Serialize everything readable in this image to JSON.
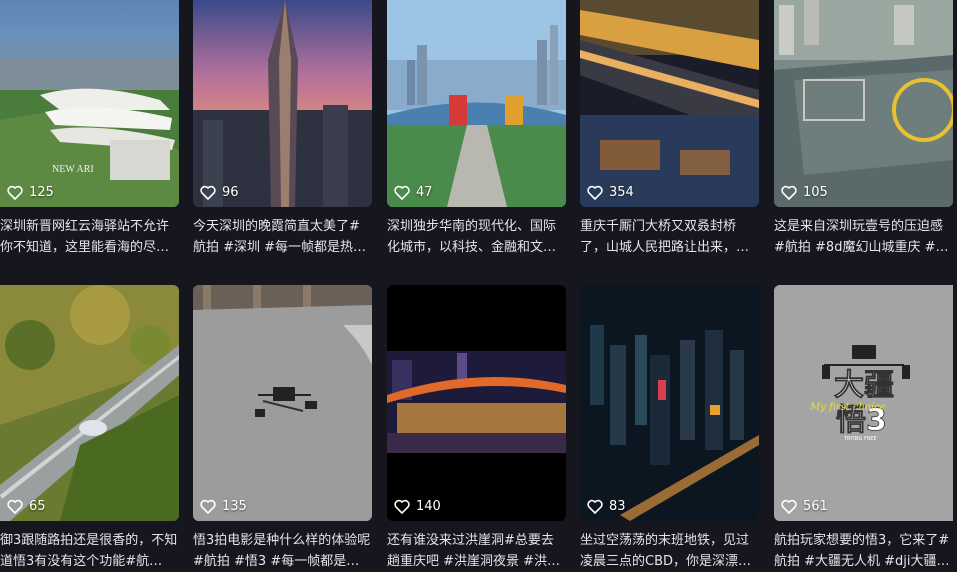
{
  "videos": [
    {
      "likes": "125",
      "caption": "深圳新晋网红云海驿站不允许你不知道，这里能看海的尽…"
    },
    {
      "likes": "96",
      "caption": "今天深圳的晚霞简直太美了#航拍 #深圳 #每一帧都是热…"
    },
    {
      "likes": "47",
      "caption": "深圳独步华南的现代化、国际化城市，以科技、金融和文…"
    },
    {
      "likes": "354",
      "caption": "重庆千厮门大桥又双叒封桥了，山城人民把路让出来，…"
    },
    {
      "likes": "105",
      "caption": "这是来自深圳玩壹号的压迫感 #航拍 #8d魔幻山城重庆 #…"
    },
    {
      "likes": "65",
      "caption": "御3跟随路拍还是很香的，不知道悟3有没有这个功能#航…"
    },
    {
      "likes": "135",
      "caption": "悟3拍电影是种什么样的体验呢#航拍 #悟3 #每一帧都是…"
    },
    {
      "likes": "140",
      "caption": "还有谁没来过洪崖洞#总要去趟重庆吧 #洪崖洞夜景 #洪…"
    },
    {
      "likes": "83",
      "caption": "坐过空荡荡的末班地铁，见过凌晨三点的CBD，你是深漂…"
    },
    {
      "likes": "561",
      "caption": "航拍玩家想要的悟3，它来了#航拍 #大疆无人机 #dji大疆 …"
    }
  ],
  "thumb_text": {
    "t1_sign": "NEW ARI",
    "t10_logo_line1": "大疆",
    "t10_logo_line2": "悟3",
    "t10_logo_script": "My first choice",
    "t10_logo_sub": "TRYING FREE"
  },
  "icons": {
    "like": "heart-icon"
  }
}
